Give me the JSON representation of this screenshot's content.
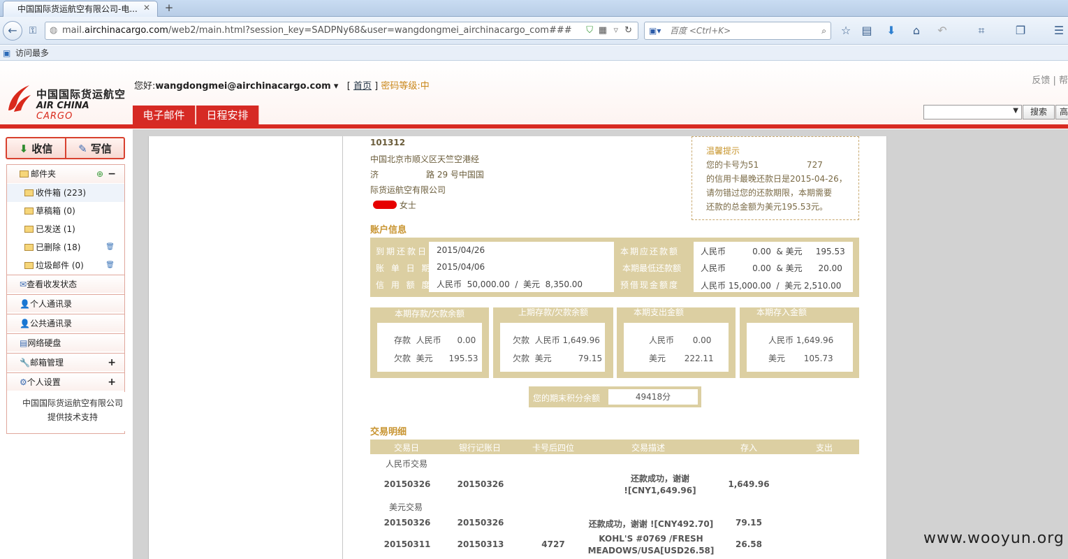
{
  "browser": {
    "tab_title": "中国国际货运航空有限公司-电...",
    "new_tab": "+",
    "url_prefix": "mail.",
    "url_domain": "airchinacargo.com",
    "url_rest": "/web2/main.html?session_key=SADPNy68&user=wangdongmei_airchinacargo_com###",
    "search_placeholder": "百度 <Ctrl+K>",
    "bookmark": "访问最多"
  },
  "header": {
    "logo_cn": "中国国际货运航空",
    "logo_en": "AIR CHINA",
    "logo_en2": "CARGO",
    "greeting": "您好:",
    "user": "wangdongmei@airchinacargo.com",
    "home_link": "首页",
    "pw_level": "密码等级:中",
    "top_links": "反馈 | 帮",
    "tabs": [
      "电子邮件",
      "日程安排"
    ],
    "search_btn": "搜索",
    "adv_btn": "高"
  },
  "sidebar": {
    "receive": "收信",
    "compose": "写信",
    "folder_root": "邮件夹",
    "folders": [
      "收件箱 (223)",
      "草稿箱 (0)",
      "已发送 (1)",
      "已删除 (18)",
      "垃圾邮件 (0)"
    ],
    "sections": [
      "查看收发状态",
      "个人通讯录",
      "公共通讯录",
      "网络硬盘",
      "邮箱管理",
      "个人设置"
    ],
    "support1": "中国国际货运航空有限公司",
    "support2": "提供技术支持"
  },
  "statement": {
    "postcode": "101312",
    "addr1": "中国北京市顺义区天竺空港经",
    "addr2a": "济",
    "addr2b": "路 29 号中国国",
    "addr3": "际货运航空有限公司",
    "addr4": "女士",
    "hint_title": "温馨提示",
    "hint_lines": [
      "您的卡号为51                  727",
      "的信用卡最晚还款日是2015-04-26，",
      "请勿错过您的还款期限，本期需要",
      "还款的总金额为美元195.53元。"
    ],
    "acct_title": "账户信息",
    "acct_labels_left": [
      "到期还款日",
      "账 单 日 期",
      "信 用 额 度"
    ],
    "acct_vals_left": [
      "2015/04/26",
      "2015/04/06",
      "人民币  50,000.00  /  美元  8,350.00"
    ],
    "acct_labels_right": [
      "本期应还款额",
      "本期最低还款额",
      "预借现金额度"
    ],
    "acct_vals_right": [
      "人民币          0.00  & 美元     195.53",
      "人民币          0.00  & 美元      20.00",
      "人民币 15,000.00  /  美元 2,510.00"
    ],
    "balance_heads": [
      "本期存款/欠款余额",
      "上期存款/欠款余额",
      "本期支出金额",
      "本期存入金额"
    ],
    "balance_rows": [
      [
        "存款  人民币      0.00",
        "欠款  美元      195.53"
      ],
      [
        "欠款  人民币 1,649.96",
        "欠款  美元          79.15"
      ],
      [
        "人民币       0.00",
        "美元       222.11"
      ],
      [
        "人民币 1,649.96",
        "美元       105.73"
      ]
    ],
    "points_label": "您的期末积分余额",
    "points_value": "49418分",
    "tx_title": "交易明细",
    "tx_headers": [
      "交易日",
      "银行记账日",
      "卡号后四位",
      "交易描述",
      "存入",
      "支出"
    ],
    "rmb_label": "人民币交易",
    "usd_label": "美元交易",
    "tx_rows": [
      {
        "date": "20150326",
        "post": "20150326",
        "card": "",
        "desc1": "还款成功，谢谢",
        "desc2": "![CNY1,649.96]",
        "in": "1,649.96",
        "out": ""
      },
      {
        "date": "20150326",
        "post": "20150326",
        "card": "",
        "desc1": "还款成功，谢谢 ![CNY492.70]",
        "desc2": "",
        "in": "79.15",
        "out": ""
      },
      {
        "date": "20150311",
        "post": "20150313",
        "card": "4727",
        "desc1": "KOHL'S #0769 /FRESH",
        "desc2": "MEADOWS/USA[USD26.58]",
        "in": "26.58",
        "out": ""
      }
    ]
  },
  "watermark": "www.wooyun.org"
}
